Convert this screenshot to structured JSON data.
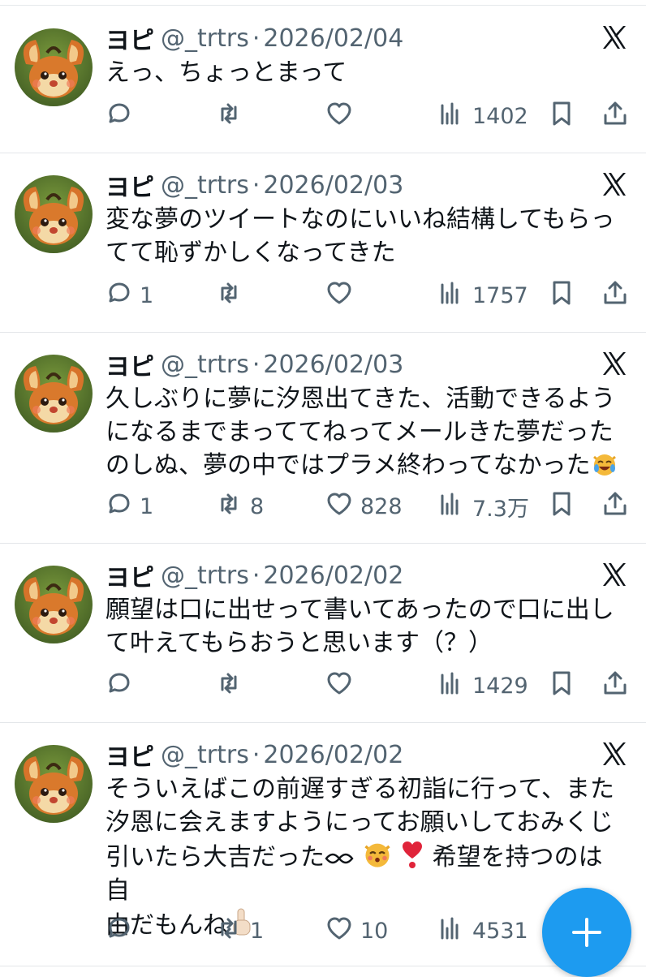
{
  "tweets": [
    {
      "name": "ヨピ",
      "handle": "@_trtrs",
      "sep": "·",
      "date": "2026/02/04",
      "lines": [
        "えっ、ちょっとまって"
      ],
      "replies": "",
      "retweets": "",
      "likes": "",
      "views": "1402"
    },
    {
      "name": "ヨピ",
      "handle": "@_trtrs",
      "sep": "·",
      "date": "2026/02/03",
      "lines": [
        "変な夢のツイートなのにいいね結構してもらっ",
        "てて恥ずかしくなってきた"
      ],
      "replies": "1",
      "retweets": "",
      "likes": "",
      "views": "1757"
    },
    {
      "name": "ヨピ",
      "handle": "@_trtrs",
      "sep": "·",
      "date": "2026/02/03",
      "lines": [
        "久しぶりに夢に汐恩出てきた、活動できるよう",
        "になるまでまっててねってメールきた夢だった",
        "のしぬ、夢の中ではプラメ終わってなかった"
      ],
      "replies": "1",
      "retweets": "8",
      "likes": "828",
      "views": "7.3万"
    },
    {
      "name": "ヨピ",
      "handle": "@_trtrs",
      "sep": "·",
      "date": "2026/02/02",
      "lines": [
        "願望は口に出せって書いてあったので口に出し",
        "て叶えてもらおうと思います（？）"
      ],
      "replies": "",
      "retweets": "",
      "likes": "",
      "views": "1429"
    },
    {
      "name": "ヨピ",
      "handle": "@_trtrs",
      "sep": "·",
      "date": "2026/02/02",
      "lines": [
        "そういえばこの前遅すぎる初詣に行って、また",
        "汐恩に会えますようにってお願いしておみくじ",
        "引いたら大吉だった",
        " 希望を持つのは自",
        "由だもんね"
      ],
      "replies": "",
      "retweets": "1",
      "likes": "10",
      "views": "4531"
    }
  ],
  "icons": {
    "reply": "speech-bubble-icon",
    "retweet": "retweet-arrows-icon",
    "like": "heart-icon",
    "views": "bar-chart-icon",
    "bookmark": "bookmark-icon",
    "share": "share-upload-icon",
    "platform": "x-logo-icon",
    "compose": "plus-icon"
  },
  "colors": {
    "accent": "#1d9bf0",
    "muted": "#536471",
    "text": "#0f1419"
  }
}
